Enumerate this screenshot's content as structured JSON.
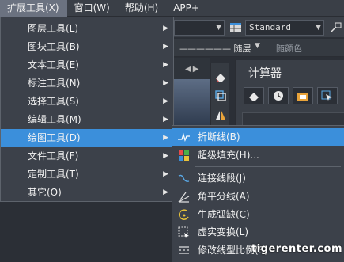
{
  "menubar": {
    "items": [
      {
        "label": "扩展工具(X)",
        "active": true
      },
      {
        "label": "窗口(W)"
      },
      {
        "label": "帮助(H)"
      },
      {
        "label": "APP+"
      }
    ]
  },
  "toolbar": {
    "style_combo": "Standard",
    "linetype": "—————— 随层",
    "color": "随颜色"
  },
  "calculator": {
    "title": "计算器"
  },
  "extend_menu": {
    "items": [
      {
        "label": "图层工具(L)",
        "has_submenu": true
      },
      {
        "label": "图块工具(B)",
        "has_submenu": true
      },
      {
        "label": "文本工具(E)",
        "has_submenu": true
      },
      {
        "label": "标注工具(N)",
        "has_submenu": true
      },
      {
        "label": "选择工具(S)",
        "has_submenu": true
      },
      {
        "label": "编辑工具(M)",
        "has_submenu": true
      },
      {
        "label": "绘图工具(D)",
        "has_submenu": true,
        "selected": true
      },
      {
        "label": "文件工具(F)",
        "has_submenu": true
      },
      {
        "label": "定制工具(T)",
        "has_submenu": true
      },
      {
        "label": "其它(O)",
        "has_submenu": true
      }
    ]
  },
  "draw_submenu": {
    "items": [
      {
        "label": "折断线(B)",
        "icon": "break-line-icon",
        "selected": true
      },
      {
        "label": "超级填充(H)...",
        "icon": "super-hatch-icon"
      },
      {
        "label": "连接线段(J)",
        "icon": "join-segments-icon"
      },
      {
        "label": "角平分线(A)",
        "icon": "angle-bisector-icon"
      },
      {
        "label": "生成弧缺(C)",
        "icon": "arc-gap-icon"
      },
      {
        "label": "虚实变换(L)",
        "icon": "dash-solid-toggle-icon"
      },
      {
        "label": "修改线型比例(S)",
        "icon": "linetype-scale-icon"
      }
    ]
  },
  "watermark": "tigerenter.com",
  "colors": {
    "menu_bg": "#3c414a",
    "highlight": "#3b8fdb",
    "menubar_bg": "#3a3f47"
  }
}
